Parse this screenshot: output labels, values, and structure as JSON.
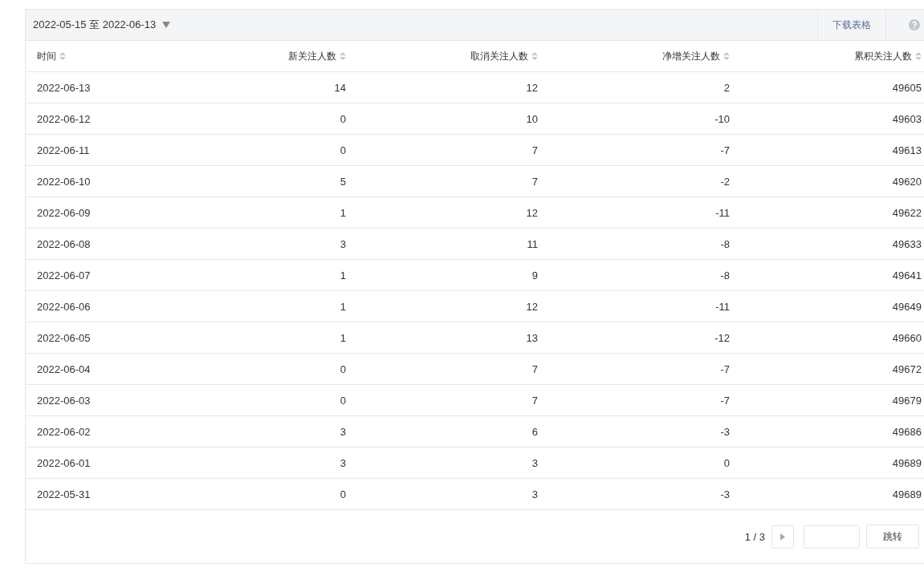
{
  "toolbar": {
    "date_range": "2022-05-15 至 2022-06-13",
    "download_link": "下载表格"
  },
  "table": {
    "columns": [
      "时间",
      "新关注人数",
      "取消关注人数",
      "净增关注人数",
      "累积关注人数"
    ],
    "rows": [
      [
        "2022-06-13",
        "14",
        "12",
        "2",
        "49605"
      ],
      [
        "2022-06-12",
        "0",
        "10",
        "-10",
        "49603"
      ],
      [
        "2022-06-11",
        "0",
        "7",
        "-7",
        "49613"
      ],
      [
        "2022-06-10",
        "5",
        "7",
        "-2",
        "49620"
      ],
      [
        "2022-06-09",
        "1",
        "12",
        "-11",
        "49622"
      ],
      [
        "2022-06-08",
        "3",
        "11",
        "-8",
        "49633"
      ],
      [
        "2022-06-07",
        "1",
        "9",
        "-8",
        "49641"
      ],
      [
        "2022-06-06",
        "1",
        "12",
        "-11",
        "49649"
      ],
      [
        "2022-06-05",
        "1",
        "13",
        "-12",
        "49660"
      ],
      [
        "2022-06-04",
        "0",
        "7",
        "-7",
        "49672"
      ],
      [
        "2022-06-03",
        "0",
        "7",
        "-7",
        "49679"
      ],
      [
        "2022-06-02",
        "3",
        "6",
        "-3",
        "49686"
      ],
      [
        "2022-06-01",
        "3",
        "3",
        "0",
        "49689"
      ],
      [
        "2022-05-31",
        "0",
        "3",
        "-3",
        "49689"
      ]
    ]
  },
  "pagination": {
    "page_indicator": "1 / 3",
    "jump_button": "跳转"
  }
}
